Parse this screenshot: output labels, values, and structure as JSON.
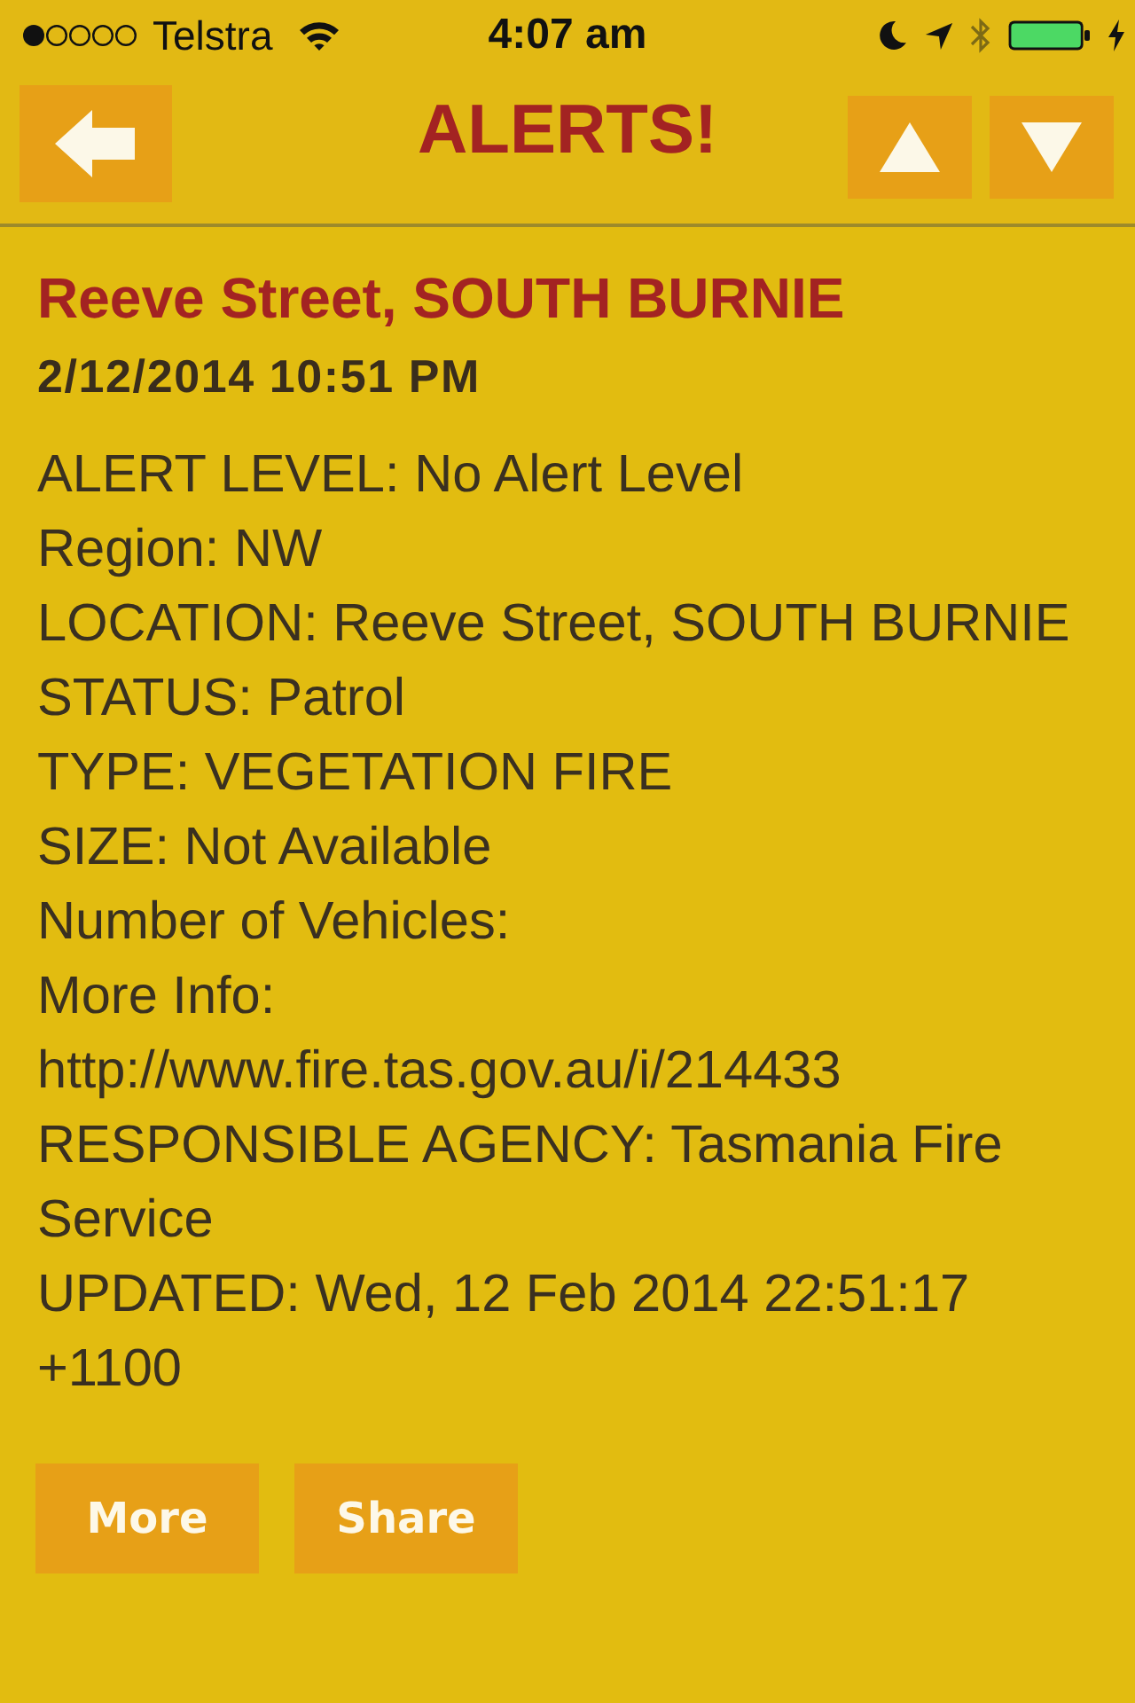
{
  "status_bar": {
    "carrier": "Telstra",
    "time": "4:07 am"
  },
  "nav": {
    "title": "ALERTS!"
  },
  "alert": {
    "title": "Reeve Street, SOUTH BURNIE",
    "datetime": "2/12/2014 10:51 PM",
    "details": [
      "ALERT LEVEL: No Alert Level",
      "Region: NW",
      "LOCATION: Reeve Street, SOUTH BURNIE",
      "STATUS: Patrol",
      "TYPE: VEGETATION FIRE",
      "SIZE: Not Available",
      "Number of Vehicles:",
      "More Info: http://www.fire.tas.gov.au/i/214433",
      "RESPONSIBLE AGENCY: Tasmania Fire Service",
      "UPDATED: Wed, 12 Feb 2014 22:51:17 +1100"
    ],
    "actions": [
      "More",
      "Share"
    ]
  }
}
